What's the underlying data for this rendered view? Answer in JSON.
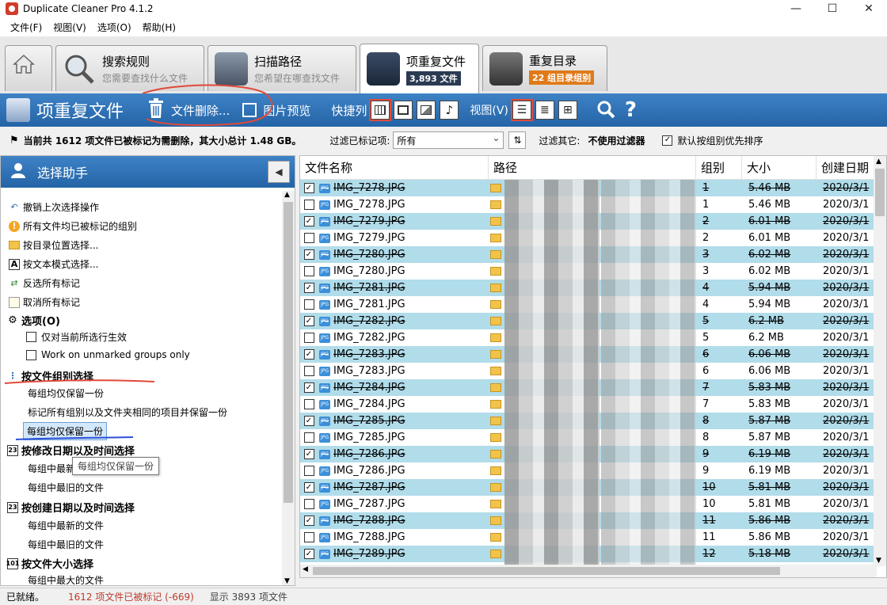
{
  "window": {
    "title": "Duplicate Cleaner Pro 4.1.2",
    "minimize": "—",
    "maximize": "☐",
    "close": "✕"
  },
  "menu": [
    "文件(F)",
    "视图(V)",
    "选项(O)",
    "帮助(H)"
  ],
  "tabs": [
    {
      "name": "",
      "sub": ""
    },
    {
      "name": "搜索规则",
      "sub": "您需要查找什么文件"
    },
    {
      "name": "扫描路径",
      "sub": "您希望在哪查找文件"
    },
    {
      "name": "项重复文件",
      "badge": "3,893 文件",
      "badge_color": "#2a3a52"
    },
    {
      "name": "重复目录",
      "badge": "22 组目录组别",
      "badge_color": "#e07a18"
    }
  ],
  "toolbar": {
    "title": "项重复文件",
    "delete": "文件删除...",
    "preview": "图片预览",
    "shortcut": "快捷列",
    "view": "视图(V)"
  },
  "filter": {
    "status_msg": "当前共 1612 项文件已被标记为需删除，其大小总计 1.48 GB。",
    "filter_label": "过滤已标记项:",
    "filter_value": "所有",
    "other_label": "过滤其它:",
    "other_value": "不使用过滤器",
    "sort_label": "默认按组别优先排序"
  },
  "assistant": {
    "title": "选择助手",
    "items": [
      {
        "label": "撤销上次选择操作",
        "icon": "undo-icon"
      },
      {
        "label": "所有文件均已被标记的组别",
        "icon": "warning-icon"
      },
      {
        "label": "按目录位置选择...",
        "icon": "folder-icon"
      },
      {
        "label": "按文本模式选择...",
        "icon": "text-icon"
      },
      {
        "label": "反选所有标记",
        "icon": "invert-icon"
      },
      {
        "label": "取消所有标记",
        "icon": "clear-icon"
      }
    ],
    "options_header": "选项(O)",
    "options": [
      "仅对当前所选行生效",
      "Work on unmarked groups only"
    ],
    "group_header": "按文件组别选择",
    "group_items": [
      "每组均仅保留一份",
      "标记所有组别以及文件夹相同的项目并保留一份",
      "每组均仅保留一份"
    ],
    "mdate_header": "按修改日期以及时间选择",
    "mdate_items": [
      "每组中最新",
      "每组中最旧的文件"
    ],
    "cdate_header": "按创建日期以及时间选择",
    "cdate_items": [
      "每组中最新的文件",
      "每组中最旧的文件"
    ],
    "size_header": "按文件大小选择",
    "size_items": [
      "每组中最大的文件"
    ],
    "tooltip": "每组均仅保留一份"
  },
  "table": {
    "columns": [
      "文件名称",
      "路径",
      "组别",
      "大小",
      "创建日期"
    ],
    "rows": [
      {
        "checked": true,
        "name": "IMG_7278.JPG",
        "group": "1",
        "size": "5.46 MB",
        "date": "2020/3/1"
      },
      {
        "checked": false,
        "name": "IMG_7278.JPG",
        "group": "1",
        "size": "5.46 MB",
        "date": "2020/3/1"
      },
      {
        "checked": true,
        "name": "IMG_7279.JPG",
        "group": "2",
        "size": "6.01 MB",
        "date": "2020/3/1"
      },
      {
        "checked": false,
        "name": "IMG_7279.JPG",
        "group": "2",
        "size": "6.01 MB",
        "date": "2020/3/1"
      },
      {
        "checked": true,
        "name": "IMG_7280.JPG",
        "group": "3",
        "size": "6.02 MB",
        "date": "2020/3/1"
      },
      {
        "checked": false,
        "name": "IMG_7280.JPG",
        "group": "3",
        "size": "6.02 MB",
        "date": "2020/3/1"
      },
      {
        "checked": true,
        "name": "IMG_7281.JPG",
        "group": "4",
        "size": "5.94 MB",
        "date": "2020/3/1"
      },
      {
        "checked": false,
        "name": "IMG_7281.JPG",
        "group": "4",
        "size": "5.94 MB",
        "date": "2020/3/1"
      },
      {
        "checked": true,
        "name": "IMG_7282.JPG",
        "group": "5",
        "size": "6.2 MB",
        "date": "2020/3/1"
      },
      {
        "checked": false,
        "name": "IMG_7282.JPG",
        "group": "5",
        "size": "6.2 MB",
        "date": "2020/3/1"
      },
      {
        "checked": true,
        "name": "IMG_7283.JPG",
        "group": "6",
        "size": "6.06 MB",
        "date": "2020/3/1"
      },
      {
        "checked": false,
        "name": "IMG_7283.JPG",
        "group": "6",
        "size": "6.06 MB",
        "date": "2020/3/1"
      },
      {
        "checked": true,
        "name": "IMG_7284.JPG",
        "group": "7",
        "size": "5.83 MB",
        "date": "2020/3/1"
      },
      {
        "checked": false,
        "name": "IMG_7284.JPG",
        "group": "7",
        "size": "5.83 MB",
        "date": "2020/3/1"
      },
      {
        "checked": true,
        "name": "IMG_7285.JPG",
        "group": "8",
        "size": "5.87 MB",
        "date": "2020/3/1"
      },
      {
        "checked": false,
        "name": "IMG_7285.JPG",
        "group": "8",
        "size": "5.87 MB",
        "date": "2020/3/1"
      },
      {
        "checked": true,
        "name": "IMG_7286.JPG",
        "group": "9",
        "size": "6.19 MB",
        "date": "2020/3/1"
      },
      {
        "checked": false,
        "name": "IMG_7286.JPG",
        "group": "9",
        "size": "6.19 MB",
        "date": "2020/3/1"
      },
      {
        "checked": true,
        "name": "IMG_7287.JPG",
        "group": "10",
        "size": "5.81 MB",
        "date": "2020/3/1"
      },
      {
        "checked": false,
        "name": "IMG_7287.JPG",
        "group": "10",
        "size": "5.81 MB",
        "date": "2020/3/1"
      },
      {
        "checked": true,
        "name": "IMG_7288.JPG",
        "group": "11",
        "size": "5.86 MB",
        "date": "2020/3/1"
      },
      {
        "checked": false,
        "name": "IMG_7288.JPG",
        "group": "11",
        "size": "5.86 MB",
        "date": "2020/3/1"
      },
      {
        "checked": true,
        "name": "IMG_7289.JPG",
        "group": "12",
        "size": "5.18 MB",
        "date": "2020/3/1"
      }
    ]
  },
  "status": {
    "ready": "已就绪。",
    "marked": "1612 项文件已被标记 (-669)",
    "shown": "显示 3893 项文件"
  },
  "colors": {
    "accent": "#2e6fb4",
    "marked_row": "#b1dcea",
    "annotation_red": "#e04a3a",
    "annotation_blue": "#2a4fd8"
  }
}
